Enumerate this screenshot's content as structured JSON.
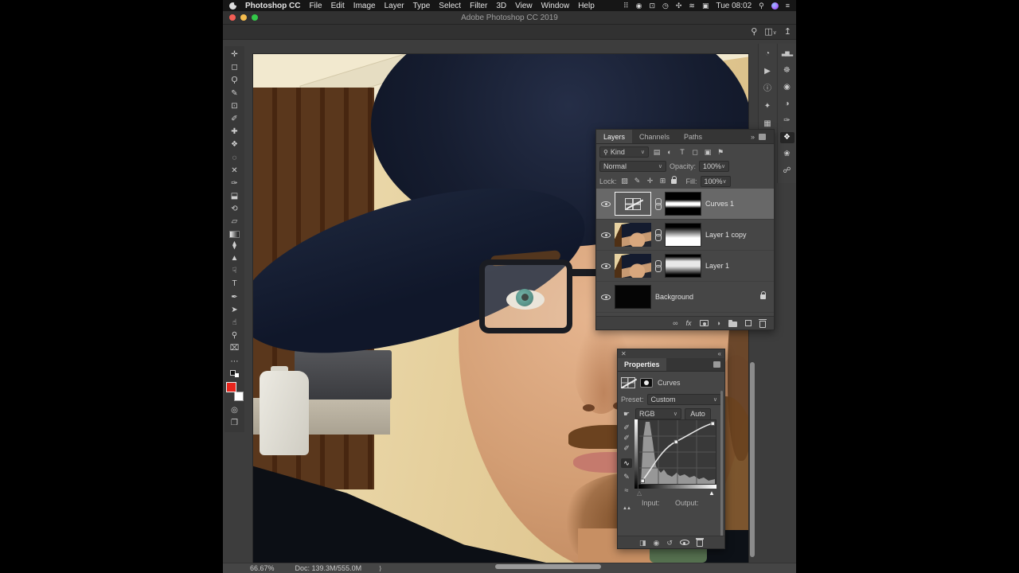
{
  "menubar": {
    "app_name": "Photoshop CC",
    "menus": [
      "File",
      "Edit",
      "Image",
      "Layer",
      "Type",
      "Select",
      "Filter",
      "3D",
      "View",
      "Window",
      "Help"
    ],
    "clock": "Tue 08:02",
    "status_icons": {
      "dropbox": "⠿",
      "app_circle": "◉",
      "display": "⊡",
      "time_machine": "◷",
      "fan": "✣",
      "wifi": "≋",
      "input_source": "▣",
      "spotlight": "⚲",
      "notification_list": "≡"
    }
  },
  "window": {
    "title": "Adobe Photoshop CC 2019",
    "toolbar_icons": {
      "search": "⚲",
      "workspace": "◫",
      "workspace_chevron": "∨",
      "share": "↥"
    }
  },
  "tools": [
    {
      "name": "move-tool",
      "glyph": "✛"
    },
    {
      "name": "marquee-tool",
      "glyph": "◻"
    },
    {
      "name": "lasso-tool",
      "glyph": "Ϙ"
    },
    {
      "name": "quick-selection-tool",
      "glyph": "✎"
    },
    {
      "name": "crop-tool",
      "glyph": "⊡"
    },
    {
      "name": "eyedropper-tool",
      "glyph": "✐"
    },
    {
      "name": "spot-healing-tool",
      "glyph": "✚"
    },
    {
      "name": "patch-tool",
      "glyph": "❖"
    },
    {
      "name": "content-aware-tool",
      "glyph": "◌"
    },
    {
      "name": "slice-x-tool",
      "glyph": "✕"
    },
    {
      "name": "brush-tool",
      "glyph": "✑"
    },
    {
      "name": "clone-stamp-tool",
      "glyph": "⬓"
    },
    {
      "name": "history-brush-tool",
      "glyph": "⟲"
    },
    {
      "name": "eraser-tool",
      "glyph": "▱"
    },
    {
      "name": "gradient-tool",
      "glyph": ""
    },
    {
      "name": "blur-tool",
      "glyph": "⧫"
    },
    {
      "name": "sharpen-tool",
      "glyph": "▲"
    },
    {
      "name": "smudge-tool",
      "glyph": "☟"
    },
    {
      "name": "type-tool",
      "glyph": "T"
    },
    {
      "name": "pen-tool",
      "glyph": "✒"
    },
    {
      "name": "path-select-tool",
      "glyph": "➤"
    },
    {
      "name": "hand-tool",
      "glyph": "☝"
    },
    {
      "name": "zoom-tool",
      "glyph": "⚲"
    },
    {
      "name": "slice-tool",
      "glyph": "⌧"
    },
    {
      "name": "edit-toolbar",
      "glyph": "⋯"
    },
    {
      "name": "quick-mask",
      "glyph": "◎"
    },
    {
      "name": "screen-mode",
      "glyph": "❐"
    }
  ],
  "dock_a": [
    {
      "name": "history-panel",
      "glyph": "◔"
    },
    {
      "name": "actions-panel",
      "glyph": "▶"
    },
    {
      "name": "info-panel",
      "glyph": "ⓘ"
    },
    {
      "name": "color-panel",
      "glyph": "✦"
    },
    {
      "name": "swatches-panel",
      "glyph": "▦"
    }
  ],
  "dock_b": [
    {
      "name": "histogram-panel",
      "glyph": "▃▆▂"
    },
    {
      "name": "navigator-panel",
      "glyph": "☸"
    },
    {
      "name": "libraries-panel",
      "glyph": "◉"
    },
    {
      "name": "adjustments-panel",
      "glyph": "◑"
    },
    {
      "name": "brush-settings-panel",
      "glyph": "✑"
    },
    {
      "name": "layers-panel-icon",
      "glyph": "❖"
    },
    {
      "name": "channels-panel-icon",
      "glyph": "❀"
    },
    {
      "name": "paths-panel-icon",
      "glyph": "☍"
    }
  ],
  "layers_panel": {
    "tabs": [
      "Layers",
      "Channels",
      "Paths"
    ],
    "tab_overflow": "»",
    "filter": {
      "search_glyph": "⚲",
      "label": "Kind",
      "chevron": "∨",
      "icons": [
        "▤",
        "◐",
        "T",
        "◻",
        "▣",
        "⚑"
      ]
    },
    "blend": {
      "mode": "Normal",
      "chevron": "∨",
      "opacity_label": "Opacity:",
      "opacity_value": "100%"
    },
    "lock": {
      "label": "Lock:",
      "icons": [
        "▨",
        "✎",
        "✛",
        "⊞"
      ],
      "fill_label": "Fill:",
      "fill_value": "100%"
    },
    "layers": [
      {
        "name": "Curves 1",
        "type": "curves-adjustment",
        "selected": true
      },
      {
        "name": "Layer 1 copy",
        "type": "pixel"
      },
      {
        "name": "Layer 1",
        "type": "pixel"
      },
      {
        "name": "Background",
        "type": "background",
        "locked": true
      }
    ],
    "footer": {
      "link": "∞",
      "fx": "fx",
      "adjust": "◑"
    }
  },
  "properties_panel": {
    "close_glyph": "✕",
    "collapse_glyph": "«",
    "title": "Properties",
    "adjustment_label": "Curves",
    "preset_label": "Preset:",
    "preset_value": "Custom",
    "preset_chevron": "∨",
    "targeted_adjust_glyph": "☛",
    "channel_value": "RGB",
    "channel_chevron": "∨",
    "auto_label": "Auto",
    "tool_icons": {
      "eyedropper_black": "✐",
      "eyedropper_gray": "✐",
      "eyedropper_white": "✐",
      "point-edit": "∿",
      "pencil": "✎",
      "smooth": "≈",
      "clip-display": "▲▲"
    },
    "sliders": {
      "black_point": "△",
      "white_point": "▲"
    },
    "input_label": "Input:",
    "output_label": "Output:",
    "footer_icons": {
      "clip": "◨",
      "prev_state": "◉",
      "reset": "↺"
    }
  },
  "statusbar": {
    "zoom": "66.67%",
    "doc": "Doc: 139.3M/555.0M",
    "chevron": "⟩"
  },
  "colors": {
    "traffic_red": "#f35e55",
    "traffic_yellow": "#f6bd4e",
    "traffic_green": "#33c748",
    "foreground_swatch": "#e8251d",
    "background_swatch": "#ffffff",
    "panel_bg": "#464646",
    "selected_row": "#686868",
    "accent_cap": "#141b2e",
    "skin": "#d39e74"
  }
}
